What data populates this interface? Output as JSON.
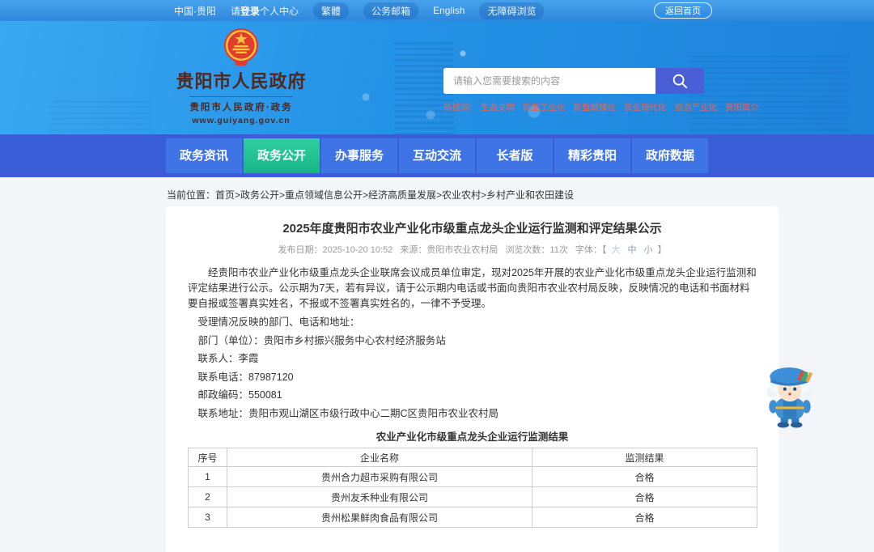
{
  "topbar": {
    "region_label": "中国·贵阳",
    "login": {
      "prefix": "请",
      "bold": "登录",
      "suffix": "个人中心"
    },
    "items": [
      {
        "label": "繁體",
        "pill": true
      },
      {
        "label": "公务邮箱",
        "pill": true
      },
      {
        "label": "English",
        "pill": false
      },
      {
        "label": "无障碍浏览",
        "pill": true
      }
    ],
    "home_button": "返回首页"
  },
  "header": {
    "site_name": "贵阳市人民政府",
    "site_tagline": "贵阳市人民政府·政务",
    "site_url": "www.guiyang.gov.cn",
    "search_placeholder": "请输入您需要搜索的内容",
    "hot_label": "热搜词：",
    "hot_words": [
      "生态文明",
      "新型工业化",
      "新型城镇化",
      "农业现代化",
      "旅游产业化",
      "贵阳简介"
    ]
  },
  "nav": {
    "tabs": [
      {
        "label": "政务资讯",
        "active": false
      },
      {
        "label": "政务公开",
        "active": true
      },
      {
        "label": "办事服务",
        "active": false
      },
      {
        "label": "互动交流",
        "active": false
      },
      {
        "label": "长者版",
        "active": false
      },
      {
        "label": "精彩贵阳",
        "active": false
      },
      {
        "label": "政府数据",
        "active": false
      }
    ]
  },
  "breadcrumb": {
    "label": "当前位置：",
    "path": "首页>政务公开>重点领域信息公开>经济高质量发展>农业农村>乡村产业和农田建设"
  },
  "article": {
    "title": "2025年度贵阳市农业产业化市级重点龙头企业运行监测和评定结果公示",
    "meta": {
      "publish": "发布日期：2025-10-20 10:52",
      "source": "来源：贵阳市农业农村局",
      "views": "浏览次数：11次",
      "font_label": "字体：【",
      "font_sizes": [
        "大",
        "中",
        "小"
      ],
      "font_close": "】"
    },
    "intro": "经贵阳市农业产业化市级重点龙头企业联席会议成员单位审定，现对2025年开展的农业产业化市级重点龙头企业运行监测和评定结果进行公示。公示期为7天，若有异议，请于公示期内电话或书面向贵阳市农业农村局反映，反映情况的电话和书面材料要自报或签署真实姓名，不报或不签署真实姓名的，一律不予受理。",
    "lines": [
      "受理情况反映的部门、电话和地址：",
      "部门（单位）：贵阳市乡村振兴服务中心农村经济服务站",
      "联系人：李霞",
      "联系电话：87987120",
      "邮政编码：550081",
      "联系地址：贵阳市观山湖区市级行政中心二期C区贵阳市农业农村局"
    ],
    "table": {
      "caption": "农业产业化市级重点龙头企业运行监测结果",
      "headers": [
        "序号",
        "企业名称",
        "监测结果"
      ],
      "rows": [
        [
          "1",
          "贵州合力超市采购有限公司",
          "合格"
        ],
        [
          "2",
          "贵州友禾种业有限公司",
          "合格"
        ],
        [
          "3",
          "贵州松果鲜肉食品有限公司",
          "合格"
        ]
      ]
    }
  },
  "icons": {
    "emblem": "national-emblem-icon",
    "search": "search-icon",
    "mascot": "service-mascot-icon"
  },
  "colors": {
    "topbar_blue": "#3b93e6",
    "header_blue_start": "#3aa7f2",
    "header_blue_end": "#1d83da",
    "nav_blue": "#3a5ed8",
    "tab_blue": "#3f74e6",
    "active_tab_green": "#1fc494",
    "search_button_indigo": "#4a5ed6",
    "hot_word_red": "#f4604f",
    "logo_maroon": "#54281c"
  }
}
